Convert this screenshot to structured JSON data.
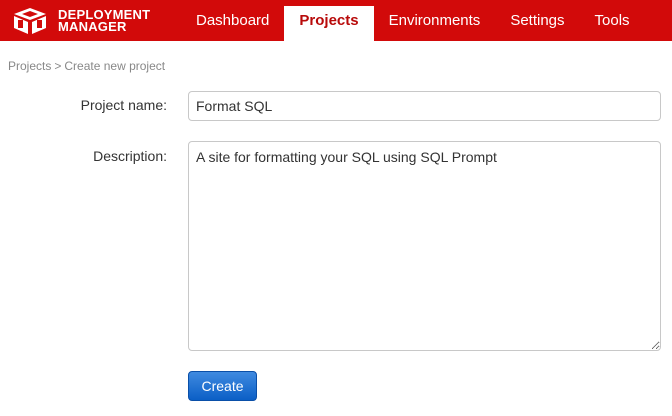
{
  "app": {
    "logo_line1": "DEPLOYMENT",
    "logo_line2": "MANAGER"
  },
  "nav": {
    "items": [
      {
        "label": "Dashboard",
        "active": false
      },
      {
        "label": "Projects",
        "active": true
      },
      {
        "label": "Environments",
        "active": false
      },
      {
        "label": "Settings",
        "active": false
      },
      {
        "label": "Tools",
        "active": false
      }
    ]
  },
  "breadcrumb": {
    "parent": "Projects",
    "separator": ">",
    "current": "Create new project"
  },
  "form": {
    "name_label": "Project name:",
    "name_value": "Format SQL",
    "description_label": "Description:",
    "description_value": "A site for formatting your SQL using SQL Prompt",
    "create_label": "Create"
  },
  "colors": {
    "brand": "#d20a0a",
    "active_nav_text": "#b80a0a",
    "button": "#0b5fc6"
  },
  "icons": {
    "logo": "red-gate-box-logo-icon"
  }
}
